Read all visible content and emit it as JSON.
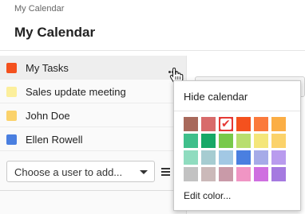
{
  "header": {
    "breadcrumb": "My Calendar",
    "title": "My Calendar"
  },
  "sidebar": {
    "calendars": [
      {
        "label": "My Tasks",
        "color": "#f4511e",
        "active": true
      },
      {
        "label": "Sales update meeting",
        "color": "#fcef9c",
        "active": false
      },
      {
        "label": "John Doe",
        "color": "#fbd26a",
        "active": false
      },
      {
        "label": "Ellen Rowell",
        "color": "#4a7fe0",
        "active": false
      }
    ],
    "user_select": {
      "placeholder": "Choose a user to add..."
    }
  },
  "popup": {
    "hide_label": "Hide calendar",
    "edit_label": "Edit color...",
    "selected_color": "#e53935",
    "palette": [
      [
        "#a8695b",
        "#d86b6b",
        "#e53935",
        "#f4511e",
        "#fb7a3c",
        "#fbae45"
      ],
      [
        "#3fbf8b",
        "#17a867",
        "#78c94a",
        "#b8de6e",
        "#f4e67a",
        "#fbd26a"
      ],
      [
        "#8fdcbf",
        "#a6ccd1",
        "#a2c8e4",
        "#4a7fe0",
        "#a6abe8",
        "#b99bee"
      ],
      [
        "#c2c2c2",
        "#cbb9b9",
        "#c99aa8",
        "#f095c4",
        "#cf6fe0",
        "#a57ae0"
      ]
    ]
  },
  "icons": {
    "more": "more-horizontal-icon",
    "cursor": "hand-pointer-icon",
    "caret": "caret-down-icon",
    "list": "list-icon",
    "check": "checkmark-icon"
  }
}
